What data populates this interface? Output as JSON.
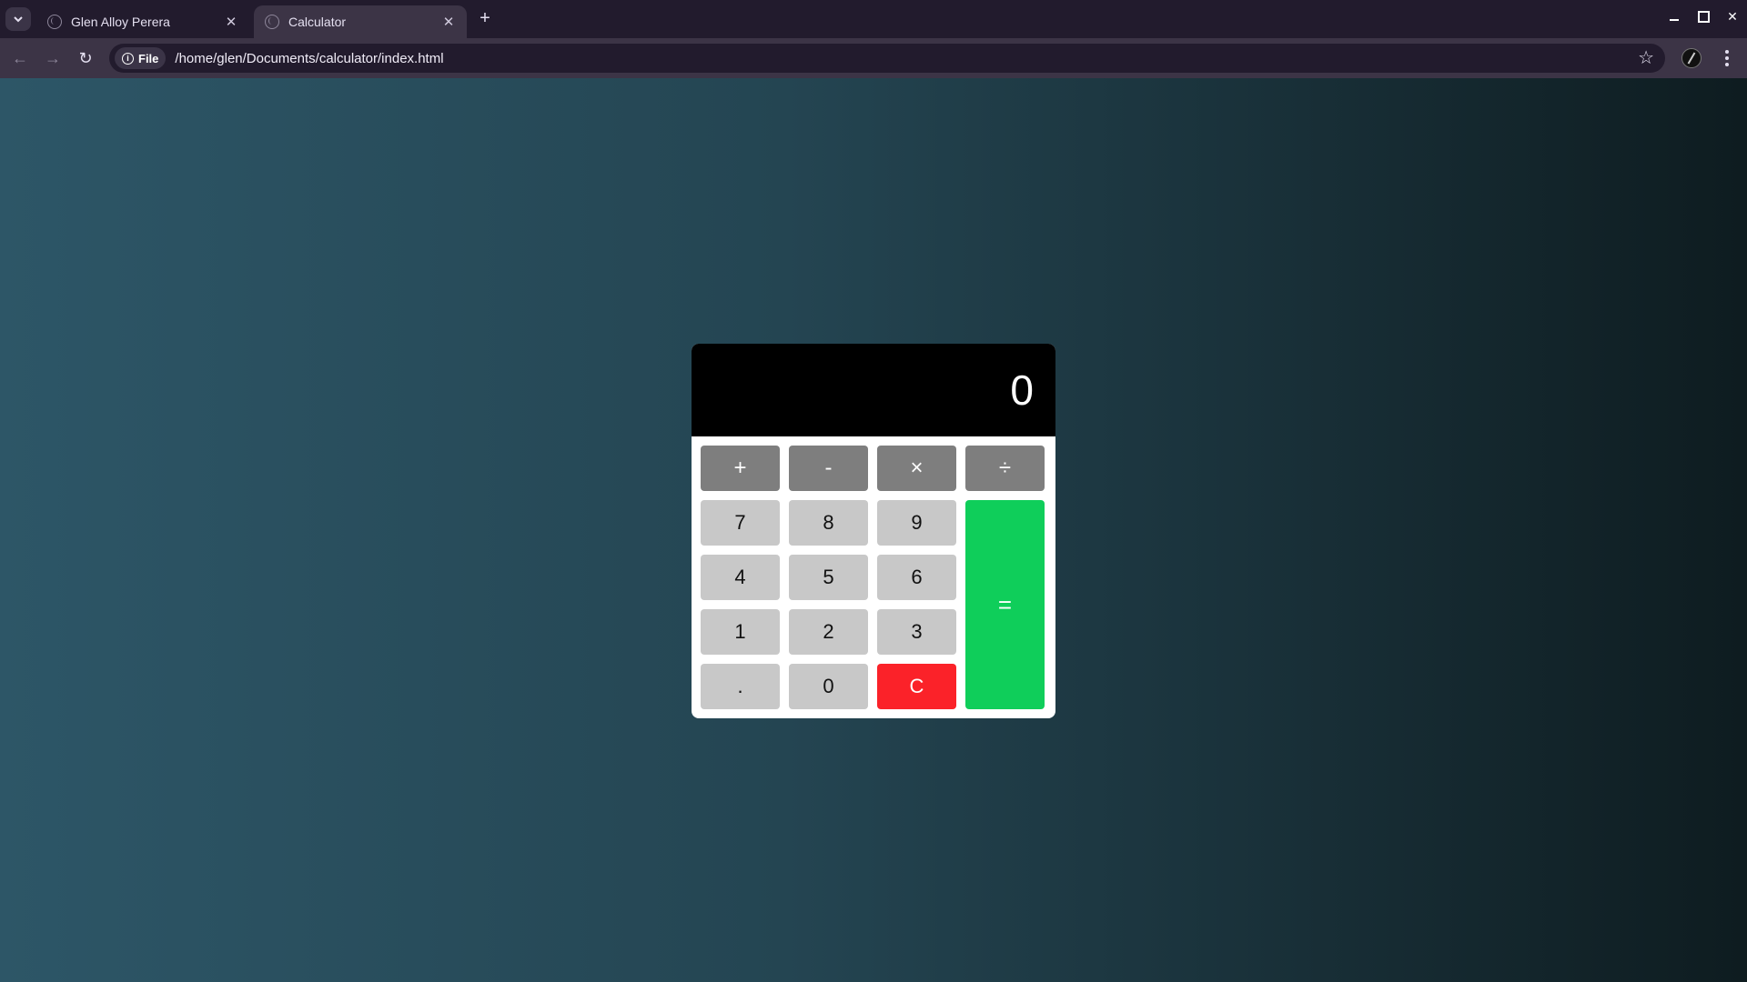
{
  "browser": {
    "tabs": [
      {
        "title": "Glen Alloy Perera",
        "active": false
      },
      {
        "title": "Calculator",
        "active": true
      }
    ],
    "close_glyph": "✕",
    "new_tab_glyph": "+",
    "address": {
      "chip_label": "File",
      "url": "/home/glen/Documents/calculator/index.html"
    },
    "icons": {
      "back": "←",
      "forward": "→",
      "reload": "↻",
      "bookmark": "☆",
      "info": "i",
      "close": "✕"
    }
  },
  "calculator": {
    "display_value": "0",
    "operators": {
      "add": "+",
      "subtract": "-",
      "multiply": "×",
      "divide": "÷"
    },
    "digits": {
      "seven": "7",
      "eight": "8",
      "nine": "9",
      "four": "4",
      "five": "5",
      "six": "6",
      "one": "1",
      "two": "2",
      "three": "3",
      "decimal": ".",
      "zero": "0"
    },
    "clear": "C",
    "equals": "=",
    "colors": {
      "operator_key": "#7e7e7e",
      "digit_key": "#c8c8c8",
      "clear_key": "#fb2229",
      "equals_key": "#0fce5a",
      "display_bg": "#000000"
    }
  }
}
